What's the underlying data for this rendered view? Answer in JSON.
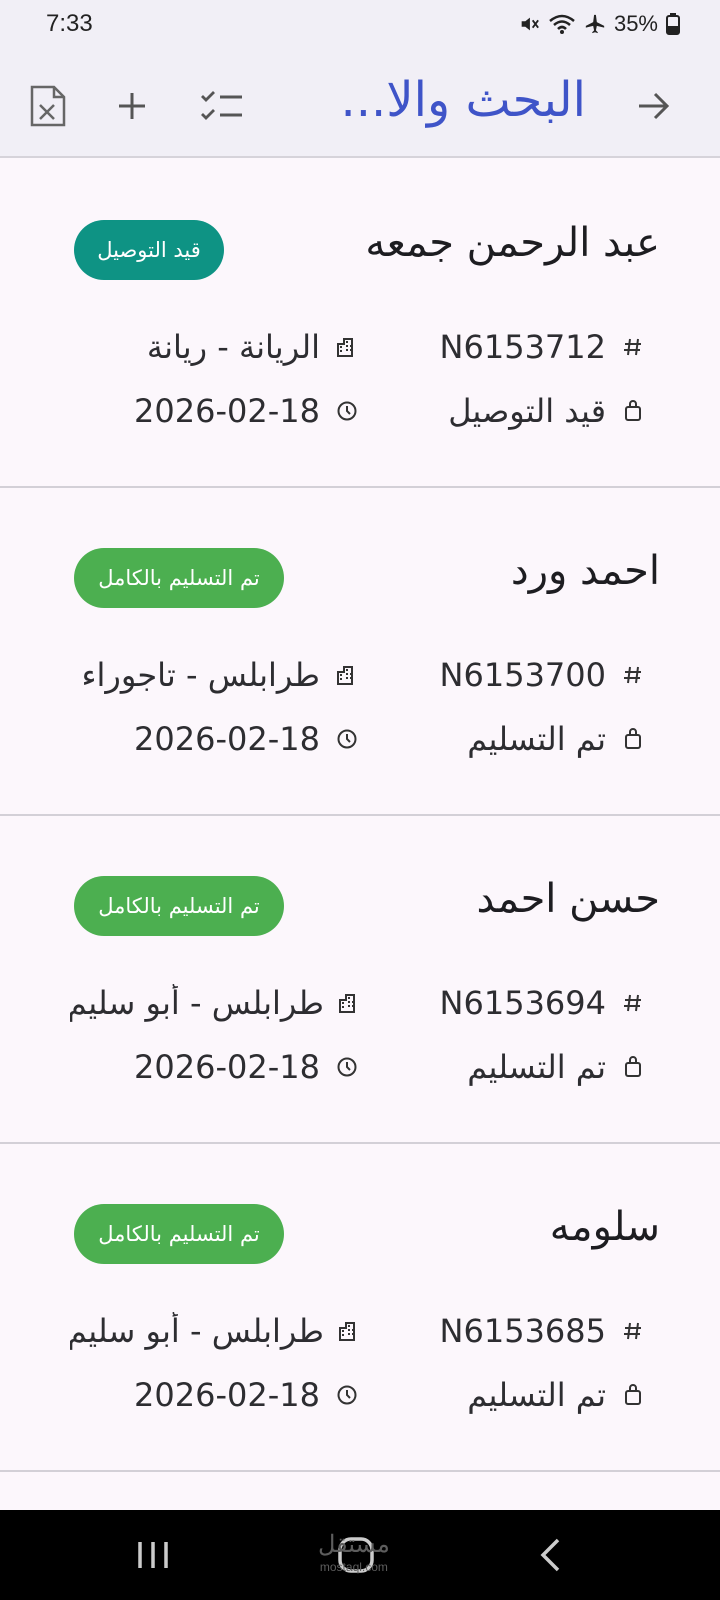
{
  "status_bar": {
    "time": "7:33",
    "battery_percent": "35%",
    "icons": [
      "mute-icon",
      "wifi-icon",
      "airplane-icon",
      "battery-icon"
    ]
  },
  "app_bar": {
    "title": "البحث والا...",
    "back_icon": "arrow-right-icon",
    "actions": [
      "checklist-icon",
      "plus-icon",
      "excel-export-icon"
    ]
  },
  "colors": {
    "accent": "#3f54c8",
    "badge_in_delivery": "#0e9384",
    "badge_delivered": "#4caf50"
  },
  "orders": [
    {
      "customer": "عبد الرحمن جمعه",
      "badge": "قيد التوصيل",
      "badge_color": "#0e9384",
      "number": "N6153712",
      "city": "الريانة - ريانة",
      "status": "قيد التوصيل",
      "date": "2026-02-18"
    },
    {
      "customer": "احمد ورد",
      "badge": "تم التسليم بالكامل",
      "badge_color": "#4caf50",
      "number": "N6153700",
      "city": "طرابلس - تاجوراء",
      "status": "تم التسليم",
      "date": "2026-02-18"
    },
    {
      "customer": "حسن احمد",
      "badge": "تم التسليم بالكامل",
      "badge_color": "#4caf50",
      "number": "N6153694",
      "city": "طرابلس - أبو سليم",
      "status": "تم التسليم",
      "date": "2026-02-18"
    },
    {
      "customer": "سلومه",
      "badge": "تم التسليم بالكامل",
      "badge_color": "#4caf50",
      "number": "N6153685",
      "city": "طرابلس - أبو سليم",
      "status": "تم التسليم",
      "date": "2026-02-18"
    }
  ],
  "watermark": {
    "text": "مستقل",
    "sub": "mostaql.com"
  }
}
